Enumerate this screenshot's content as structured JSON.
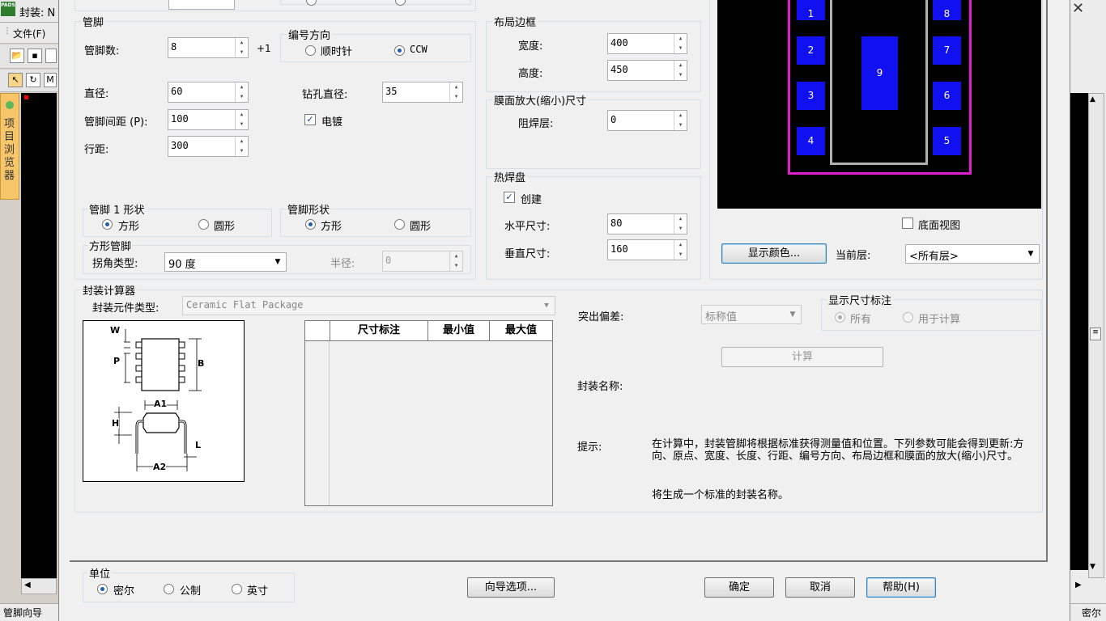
{
  "background": {
    "window_title": "封装: N",
    "menu_file": "文件(F)",
    "project_browser_tab": "项目浏览器",
    "status_left": "管脚向导",
    "status_right": "密尔"
  },
  "pins_group": {
    "label": "管脚",
    "pin_count_label": "管脚数:",
    "pin_count_value": "8",
    "plus_one": "+1",
    "numbering": {
      "label": "编号方向",
      "clockwise": "顺时针",
      "ccw": "CCW"
    },
    "diameter_label": "直径:",
    "diameter_value": "60",
    "drill_label": "钻孔直径:",
    "drill_value": "35",
    "pitch_label": "管脚间距 (P):",
    "pitch_value": "100",
    "plated_label": "电镀",
    "row_spacing_label": "行距:",
    "row_spacing_value": "300",
    "pin1_shape": {
      "label": "管脚 1 形状",
      "square": "方形",
      "round": "圆形"
    },
    "pin_shape": {
      "label": "管脚形状",
      "square": "方形",
      "round": "圆形"
    },
    "square_pin": {
      "label": "方形管脚",
      "corner_type_label": "拐角类型:",
      "corner_type_value": "90 度",
      "radius_label": "半径:",
      "radius_value": "0"
    }
  },
  "layout_border": {
    "label": "布局边框",
    "width_label": "宽度:",
    "width_value": "400",
    "height_label": "高度:",
    "height_value": "450"
  },
  "mask": {
    "label": "膜面放大(缩小)尺寸",
    "solder_mask_label": "阻焊层:",
    "solder_mask_value": "0"
  },
  "thermal_pad": {
    "label": "热焊盘",
    "create_label": "创建",
    "horizontal_label": "水平尺寸:",
    "horizontal_value": "80",
    "vertical_label": "垂直尺寸:",
    "vertical_value": "160"
  },
  "preview": {
    "pads_left": [
      "1",
      "2",
      "3",
      "4"
    ],
    "pads_right": [
      "8",
      "7",
      "6",
      "5"
    ],
    "center_pad": "9",
    "bottom_view_label": "底面视图",
    "show_colors_button": "显示颜色...",
    "current_layer_label": "当前层:",
    "current_layer_value": "<所有层>"
  },
  "calculator": {
    "label": "封装计算器",
    "component_type_label": "封装元件类型:",
    "component_type_value": "Ceramic Flat Package",
    "diagram_labels": {
      "w": "W",
      "p": "P",
      "b": "B",
      "a1": "A1",
      "h": "H",
      "l": "L",
      "a2": "A2"
    },
    "table_headers": [
      "尺寸标注",
      "最小值",
      "最大值"
    ],
    "tolerance_label": "突出偏差:",
    "tolerance_value": "标称值",
    "show_dims": {
      "label": "显示尺寸标注",
      "all": "所有",
      "for_calc": "用于计算"
    },
    "calc_button": "计算",
    "package_name_label": "封装名称:",
    "hint_label": "提示:",
    "hint_text_1": "在计算中，封装管脚将根据标准获得测量值和位置。下列参数可能会得到更新:方向、原点、宽度、长度、行距、编号方向、布局边框和膜面的放大(缩小)尺寸。",
    "hint_text_2": "将生成一个标准的封装名称。"
  },
  "units": {
    "label": "单位",
    "mil": "密尔",
    "metric": "公制",
    "inch": "英寸"
  },
  "buttons": {
    "wizard_options": "向导选项...",
    "ok": "确定",
    "cancel": "取消",
    "help": "帮助(H)"
  },
  "colors": {
    "pad_blue": "#1010f0",
    "board_outline": "#e020d0",
    "body_outline": "#b0b0b0"
  }
}
